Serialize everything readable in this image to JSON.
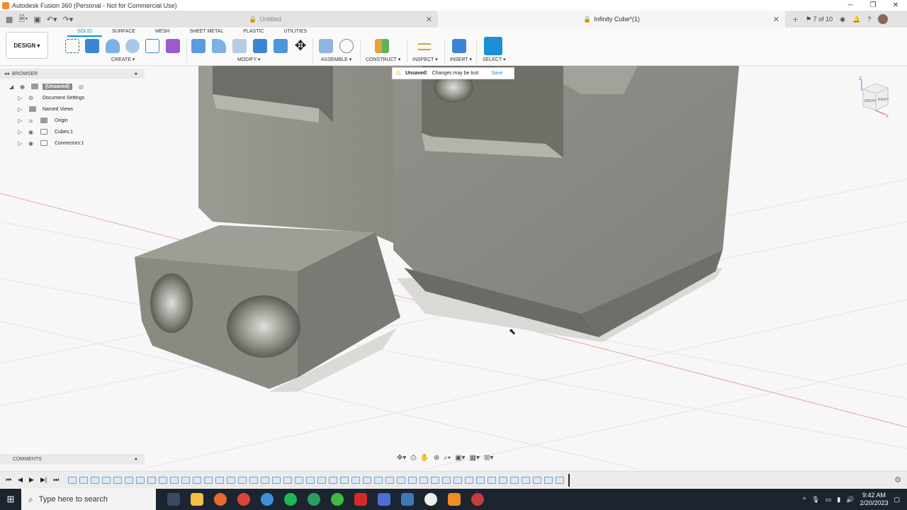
{
  "window": {
    "title": "Autodesk Fusion 360 (Personal - Not for Commercial Use)",
    "controls": [
      "─",
      "❐",
      "✕"
    ]
  },
  "tabs": [
    {
      "label": "Untitled",
      "active": false
    },
    {
      "label": "Infinity Cube*(1)",
      "active": true
    }
  ],
  "tabbar_right": {
    "version": "7 of 10"
  },
  "ribbon": {
    "workspace": "DESIGN",
    "tabs": [
      "SOLID",
      "SURFACE",
      "MESH",
      "SHEET METAL",
      "PLASTIC",
      "UTILITIES"
    ],
    "active_tab": "SOLID",
    "groups": [
      "CREATE",
      "MODIFY",
      "ASSEMBLE",
      "CONSTRUCT",
      "INSPECT",
      "INSERT",
      "SELECT"
    ]
  },
  "banner": {
    "label": "Unsaved:",
    "message": "Changes may be lost",
    "action": "Save"
  },
  "browser": {
    "title": "BROWSER",
    "root": "(Unsaved)",
    "items": [
      {
        "label": "Document Settings",
        "icon": "gear-icon"
      },
      {
        "label": "Named Views",
        "icon": "folder-icon"
      },
      {
        "label": "Origin",
        "icon": "folder-icon"
      },
      {
        "label": "Cubes:1",
        "icon": "component-icon"
      },
      {
        "label": "Connectors:1",
        "icon": "component-icon"
      }
    ]
  },
  "viewcube": {
    "front": "FRONT",
    "right": "RIGHT",
    "axis_z": "Z",
    "axis_x": "X"
  },
  "comments": {
    "title": "COMMENTS"
  },
  "taskbar": {
    "search_placeholder": "Type here to search",
    "time": "9:42 AM",
    "date": "2/20/2023"
  },
  "colors": {
    "accent": "#0696d7",
    "model": "#8c8c84",
    "taskbar": "#1c2430"
  }
}
